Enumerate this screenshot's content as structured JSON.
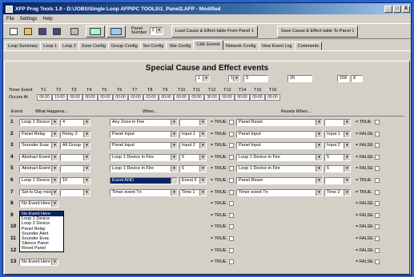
{
  "window": {
    "title": "XFP Prog Tools 1.0 - D:\\JOBS\\Single Loop AFP\\PC TOOLS\\1_Panel2.AFP - Modified",
    "controls": [
      "_",
      "□",
      "X"
    ]
  },
  "menu": [
    "File",
    "Settings",
    "Help"
  ],
  "toolbar": {
    "panel_label": "Panel Number",
    "panel_value": "2",
    "load_btn": "Load Cause & Effect table From Panel 1",
    "save_btn": "Save Cause & Effect table To Panel 1"
  },
  "tabs": [
    "Loop Summary",
    "Loop 1",
    "Loop 2",
    "Zone Config",
    "Group Config",
    "Set Config",
    "Site Config",
    "C&E Events",
    "Network Config",
    "View Event Log",
    "Comments"
  ],
  "active_tab": "C&E Events",
  "heading": "Special Cause and Effect events",
  "top_fields": [
    "1",
    "16",
    "3",
    "20",
    "158",
    "8"
  ],
  "timers": {
    "label1": "Timer Event",
    "label2": "Occurs At",
    "names": [
      "T1",
      "T2",
      "T3",
      "T4",
      "T5",
      "T6",
      "T7",
      "T8",
      "T9",
      "T10",
      "T11",
      "T12",
      "T13",
      "T14",
      "T15",
      "T16"
    ],
    "values": [
      "06:00",
      "19:00",
      "00:00",
      "00:00",
      "00:00",
      "00:00",
      "00:00",
      "03:00",
      "00:00",
      "00:00",
      "00:00",
      "30:00",
      "00:00",
      "00:00",
      "00:00",
      "00:00"
    ]
  },
  "headers": {
    "event": "Event",
    "what": "What Happens...",
    "when": "When...",
    "resets": "Resets When..."
  },
  "rows": [
    {
      "n": "1",
      "w1": "Loop 1 Device",
      "w2": "4",
      "c1": "Any Zone in Fire",
      "c2": "",
      "e1": "= TRUE",
      "r1": "Panel Reset",
      "r2": "",
      "e2": "= TRUE"
    },
    {
      "n": "2",
      "w1": "Panel Relay",
      "w2": "Relay 2",
      "c1": "Panel Input",
      "c2": "Input 1",
      "e1": "= TRUE",
      "r1": "Panel Input",
      "r2": "Input 1",
      "e2": "= FALSE"
    },
    {
      "n": "3",
      "w1": "Sounder Evac",
      "w2": "All Group",
      "c1": "Panel Input",
      "c2": "Input 2",
      "e1": "= TRUE",
      "r1": "Panel Input",
      "r2": "Input 2",
      "e2": "= FALSE"
    },
    {
      "n": "4",
      "w1": "Abstract Event",
      "w2": "",
      "c1": "Loop 1 Device in Fire",
      "c2": "5",
      "e1": "= TRUE",
      "r1": "Loop 1 Device in Fire",
      "r2": "5",
      "e2": "= FALSE"
    },
    {
      "n": "5",
      "w1": "Abstract Event",
      "w2": "",
      "c1": "Loop 1 Device in Fire",
      "c2": "6",
      "e1": "= TRUE",
      "r1": "Loop 1 Device in Fire",
      "r2": "6",
      "e2": "= FALSE"
    },
    {
      "n": "6",
      "w1": "Loop 1 Device",
      "w2": "10",
      "c1": "Event AND",
      "c2": "Event 5",
      "e1": "= TRUE",
      "r1": "Panel Reset",
      "r2": "",
      "e2": "= TRUE"
    },
    {
      "n": "7",
      "w1": "Set to Day mod",
      "w2": "",
      "c1": "Timer event Tn",
      "c2": "Time 1",
      "e1": "= TRUE",
      "r1": "Timer event Tn",
      "r2": "Time 2",
      "e2": "= TRUE"
    },
    {
      "n": "8",
      "w1": "No Event Here",
      "w2": "",
      "c1": "",
      "c2": "",
      "e1": "= TRUE",
      "r1": "",
      "r2": "",
      "e2": "= FALSE"
    },
    {
      "n": "9",
      "w1": "No Event Here",
      "w2": "",
      "c1": "",
      "c2": "",
      "e1": "= TRUE",
      "r1": "",
      "r2": "",
      "e2": "= FALSE"
    },
    {
      "n": "10",
      "w1": "",
      "w2": "",
      "c1": "",
      "c2": "",
      "e1": "= TRUE",
      "r1": "",
      "r2": "",
      "e2": "= FALSE"
    },
    {
      "n": "11",
      "w1": "",
      "w2": "",
      "c1": "",
      "c2": "",
      "e1": "= TRUE",
      "r1": "",
      "r2": "",
      "e2": "= FALSE"
    },
    {
      "n": "12",
      "w1": "",
      "w2": "",
      "c1": "",
      "c2": "",
      "e1": "= TRUE",
      "r1": "",
      "r2": "",
      "e2": "= FALSE"
    },
    {
      "n": "13",
      "w1": "No Event Here",
      "w2": "",
      "c1": "",
      "c2": "",
      "e1": "= TRUE",
      "r1": "",
      "r2": "",
      "e2": "= FALSE"
    }
  ],
  "dropdown": {
    "items": [
      "No Event Here",
      "Loop 1 Device",
      "Loop 2 Device",
      "Panel Relay",
      "Sounder Alert",
      "Sounder Evac",
      "Silence Panel",
      "Reset Panel"
    ],
    "selected": "No Event Here"
  }
}
